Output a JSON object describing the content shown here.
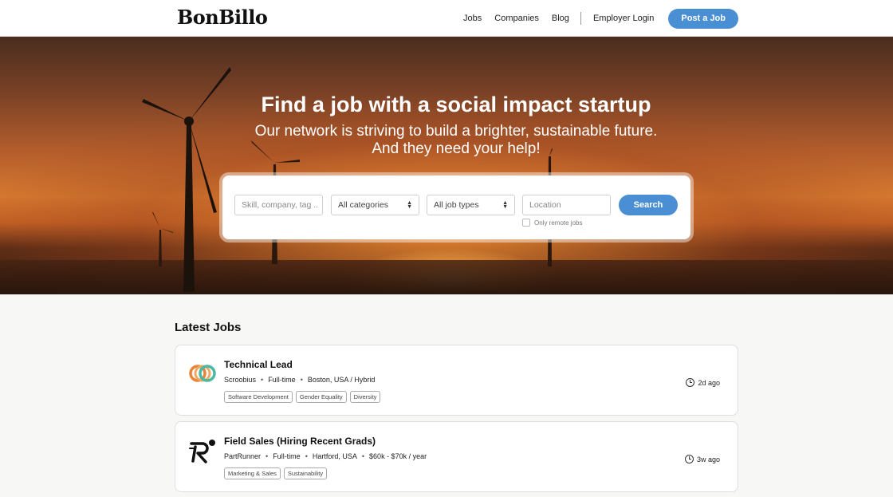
{
  "brand": {
    "logo_text": "BonBillo"
  },
  "nav": {
    "items": [
      "Jobs",
      "Companies",
      "Blog"
    ],
    "employer_login": "Employer Login",
    "post_job": "Post a Job"
  },
  "hero": {
    "title": "Find a job with a social impact startup",
    "subtitle_line1": "Our network is striving to build a brighter, sustainable future.",
    "subtitle_line2": "And they need your help!"
  },
  "search": {
    "skill_placeholder": "Skill, company, tag ..",
    "category_selected": "All categories",
    "job_type_selected": "All job types",
    "location_placeholder": "Location",
    "button": "Search",
    "remote_label": "Only remote jobs",
    "remote_checked": false
  },
  "latest_jobs": {
    "heading": "Latest Jobs",
    "jobs": [
      {
        "title": "Technical Lead",
        "company": "Scroobius",
        "type": "Full-time",
        "location": "Boston, USA / Hybrid",
        "tags": [
          "Software Development",
          "Gender Equality",
          "Diversity"
        ],
        "posted": "2d ago",
        "logo_icon": "overlapping-rings-icon"
      },
      {
        "title": "Field Sales (Hiring Recent Grads)",
        "company": "PartRunner",
        "type": "Full-time",
        "location": "Hartford, USA",
        "salary": "$60k - $70k / year",
        "tags": [
          "Marketing & Sales",
          "Sustainability"
        ],
        "posted": "3w ago",
        "logo_icon": "running-r-icon"
      }
    ]
  },
  "colors": {
    "accent": "#4a8fd4",
    "logo_ring_orange": "#e8843a",
    "logo_ring_teal": "#4bb8a5"
  }
}
